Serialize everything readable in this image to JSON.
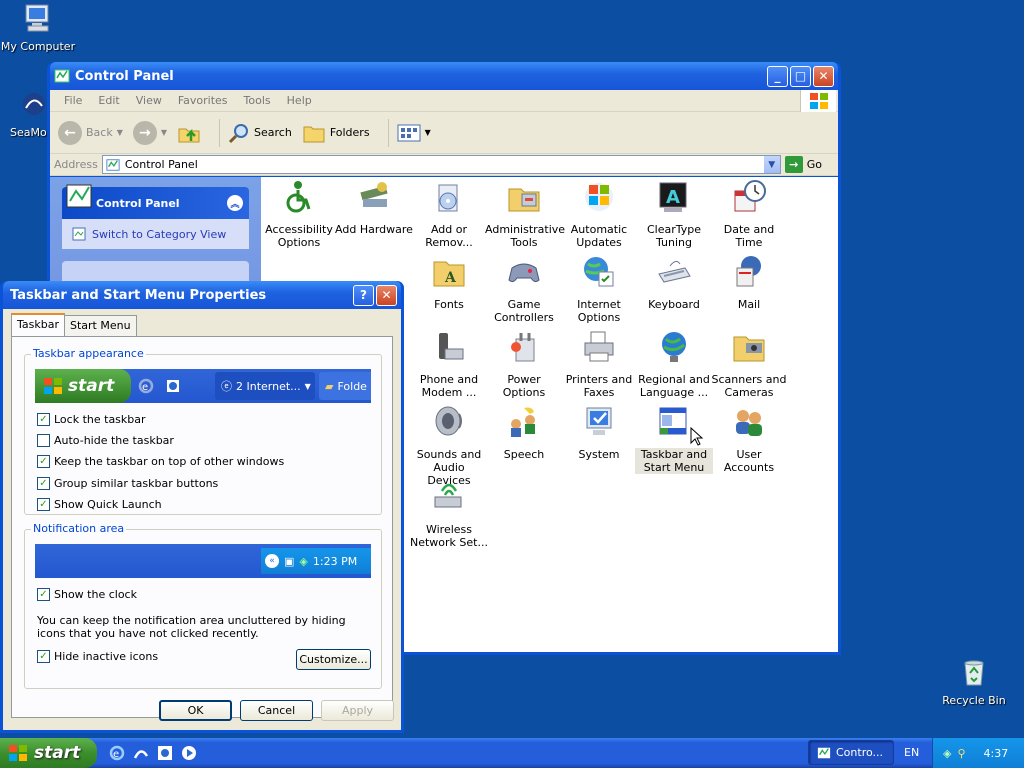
{
  "desktop": {
    "icons": [
      {
        "label": "My Computer"
      },
      {
        "label": "SeaMo"
      },
      {
        "label": "Recycle Bin"
      }
    ]
  },
  "control_panel": {
    "title": "Control Panel",
    "menu": [
      "File",
      "Edit",
      "View",
      "Favorites",
      "Tools",
      "Help"
    ],
    "toolbar": {
      "back": "Back",
      "search": "Search",
      "folders": "Folders"
    },
    "address": {
      "label": "Address",
      "value": "Control Panel",
      "go": "Go"
    },
    "side": {
      "title": "Control Panel",
      "switch_link": "Switch to Category View"
    },
    "items": [
      {
        "label": "Accessibility Options",
        "icon": "accessibility-icon"
      },
      {
        "label": "Add Hardware",
        "icon": "hardware-icon"
      },
      {
        "label": "Add or Remov...",
        "icon": "add-remove-icon"
      },
      {
        "label": "Administrative Tools",
        "icon": "admin-tools-icon"
      },
      {
        "label": "Automatic Updates",
        "icon": "updates-icon"
      },
      {
        "label": "ClearType Tuning",
        "icon": "cleartype-icon"
      },
      {
        "label": "Date and Time",
        "icon": "clock-icon"
      },
      {
        "label": "Fonts",
        "icon": "fonts-icon"
      },
      {
        "label": "Game Controllers",
        "icon": "gamepad-icon"
      },
      {
        "label": "Internet Options",
        "icon": "globe-icon"
      },
      {
        "label": "Keyboard",
        "icon": "keyboard-icon"
      },
      {
        "label": "Mail",
        "icon": "mail-icon"
      },
      {
        "label": "Phone and Modem ...",
        "icon": "phone-icon"
      },
      {
        "label": "Power Options",
        "icon": "power-icon"
      },
      {
        "label": "Printers and Faxes",
        "icon": "printer-icon"
      },
      {
        "label": "Regional and Language ...",
        "icon": "regional-icon"
      },
      {
        "label": "Scanners and Cameras",
        "icon": "scanner-icon"
      },
      {
        "label": "Sounds and Audio Devices",
        "icon": "speaker-icon"
      },
      {
        "label": "Speech",
        "icon": "speech-icon"
      },
      {
        "label": "System",
        "icon": "system-icon"
      },
      {
        "label": "Taskbar and Start Menu",
        "icon": "taskbar-icon"
      },
      {
        "label": "User Accounts",
        "icon": "users-icon"
      },
      {
        "label": "Wireless Network Set...",
        "icon": "wireless-icon"
      }
    ]
  },
  "dialog": {
    "title": "Taskbar and Start Menu Properties",
    "tabs": [
      "Taskbar",
      "Start Menu"
    ],
    "appearance_legend": "Taskbar appearance",
    "preview": {
      "start": "start",
      "task1": "2 Internet...",
      "task2": "Folde"
    },
    "options": [
      {
        "label": "Lock the taskbar",
        "checked": true
      },
      {
        "label": "Auto-hide the taskbar",
        "checked": false
      },
      {
        "label": "Keep the taskbar on top of other windows",
        "checked": true
      },
      {
        "label": "Group similar taskbar buttons",
        "checked": true
      },
      {
        "label": "Show Quick Launch",
        "checked": true
      }
    ],
    "notif_legend": "Notification area",
    "notif_time": "1:23 PM",
    "show_clock": {
      "label": "Show the clock",
      "checked": true
    },
    "notif_text": "You can keep the notification area uncluttered by hiding icons that you have not clicked recently.",
    "hide_inactive": {
      "label": "Hide inactive icons",
      "checked": true
    },
    "customize": "Customize...",
    "ok": "OK",
    "cancel": "Cancel",
    "apply": "Apply"
  },
  "taskbar": {
    "start": "start",
    "task": "Contro...",
    "lang": "EN",
    "clock": "4:37"
  }
}
